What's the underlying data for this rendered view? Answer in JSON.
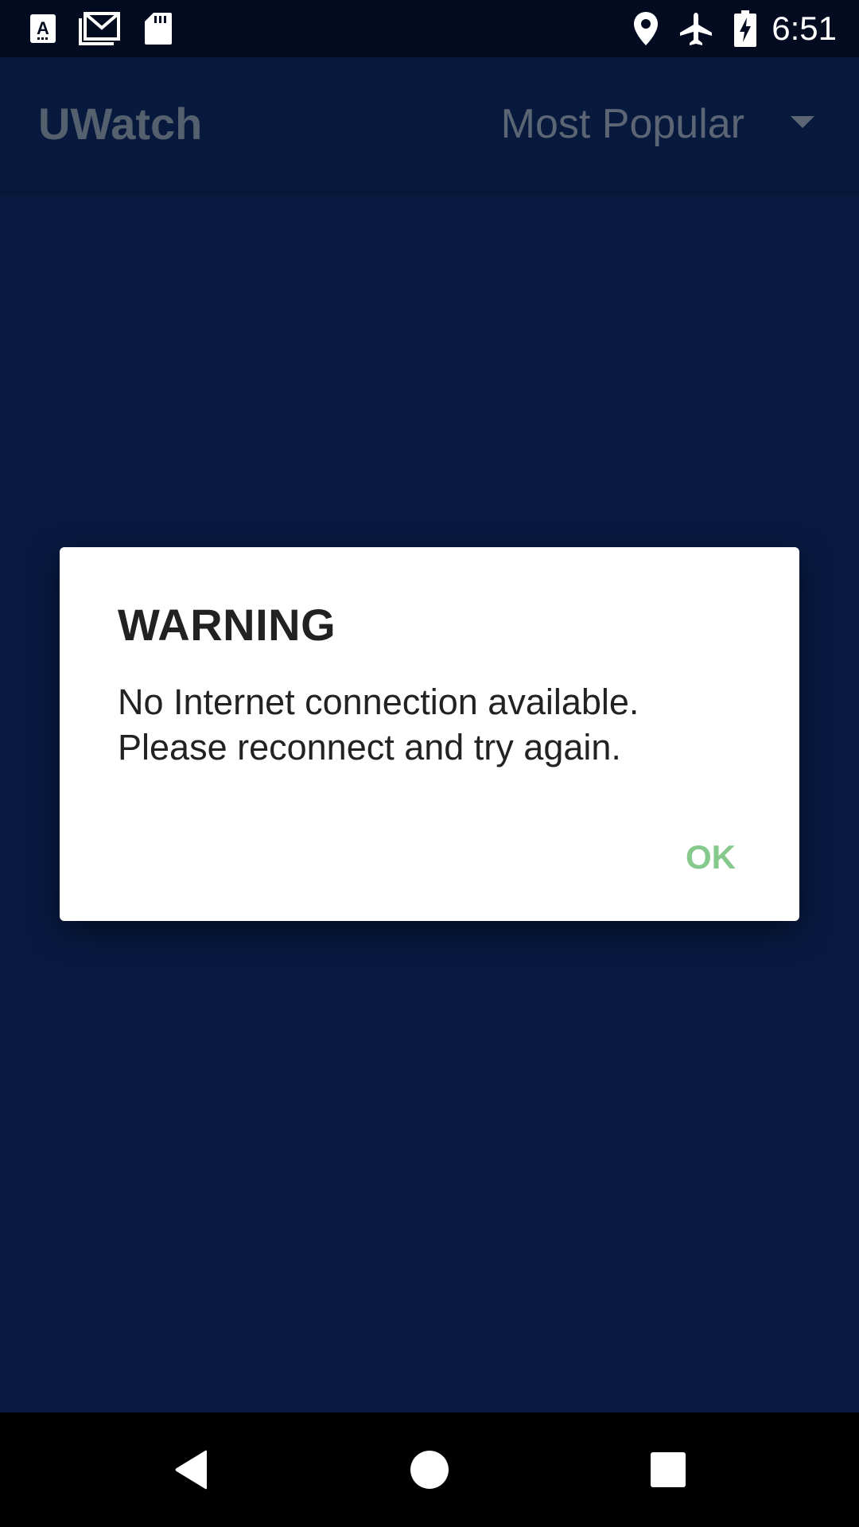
{
  "status_bar": {
    "time": "6:51",
    "left_icons": [
      "text-a-icon",
      "gmail-icon",
      "sd-card-icon"
    ],
    "right_icons": [
      "location-icon",
      "airplane-mode-icon",
      "battery-charging-icon"
    ]
  },
  "app_bar": {
    "title": "UWatch",
    "sort_selected": "Most Popular"
  },
  "dialog": {
    "title": "WARNING",
    "message": "No Internet connection available. Please reconnect and try again.",
    "ok_label": "OK"
  },
  "nav_bar": {
    "buttons": [
      "back-icon",
      "home-icon",
      "recents-icon"
    ]
  },
  "colors": {
    "status_bar_bg": "#020b1f",
    "app_bar_bg": "#071a3d",
    "content_bg": "#081a41",
    "dialog_bg": "#ffffff",
    "ok_accent": "#86c98c"
  }
}
